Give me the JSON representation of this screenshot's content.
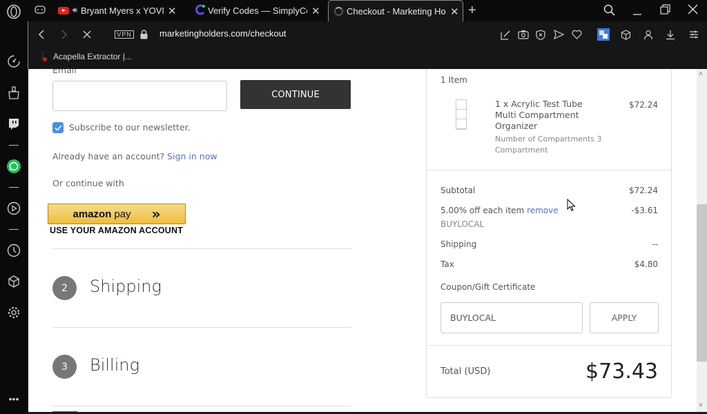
{
  "browser": {
    "tabs": [
      {
        "label": "",
        "icon": "gamepad-icon",
        "active": false
      },
      {
        "label": "Bryant Myers x YOVNGC",
        "icon": "youtube-icon",
        "audio": true,
        "active": false
      },
      {
        "label": "Verify Codes — SimplyCode",
        "icon": "simplycodes-icon",
        "active": false
      },
      {
        "label": "Checkout - Marketing Hold",
        "icon": "loading-spinner-icon",
        "active": true
      }
    ],
    "new_tab": "+",
    "address": "marketingholders.com/checkout",
    "vpn_label": "VPN",
    "bookmark": "Acapella Extractor |...",
    "brand_color": "#4a90e2"
  },
  "checkout": {
    "email_label": "Email",
    "email_value": "",
    "continue_label": "CONTINUE",
    "newsletter_label": "Subscribe to our newsletter.",
    "newsletter_checked": true,
    "account_prompt": "Already have an account?",
    "sign_in_link": "Sign in now",
    "or_continue": "Or continue with",
    "amazon_pay_word1": "amazon",
    "amazon_pay_word2": "pay",
    "amazon_pay_arrows": "»",
    "amazon_account_label": "USE YOUR AMAZON ACCOUNT",
    "steps": [
      {
        "number": "2",
        "title": "Shipping"
      },
      {
        "number": "3",
        "title": "Billing"
      }
    ]
  },
  "summary": {
    "item_count": "1 Item",
    "item": {
      "title_line1": "1 x Acrylic Test Tube",
      "title_line2": "Multi Compartment",
      "title_line3": "Organizer",
      "option_line1": "Number of Compartments 3",
      "option_line2": "Compartment",
      "price": "$72.24"
    },
    "subtotal_label": "Subtotal",
    "subtotal_value": "$72.24",
    "discount_label": "5.00% off each item",
    "discount_remove": "remove",
    "discount_code": "BUYLOCAL",
    "discount_value": "-$3.61",
    "shipping_label": "Shipping",
    "shipping_value": "--",
    "tax_label": "Tax",
    "tax_value": "$4.80",
    "coupon_label": "Coupon/Gift Certificate",
    "coupon_value": "BUYLOCAL",
    "apply_label": "APPLY",
    "total_label": "Total (USD)",
    "total_value": "$73.43"
  }
}
